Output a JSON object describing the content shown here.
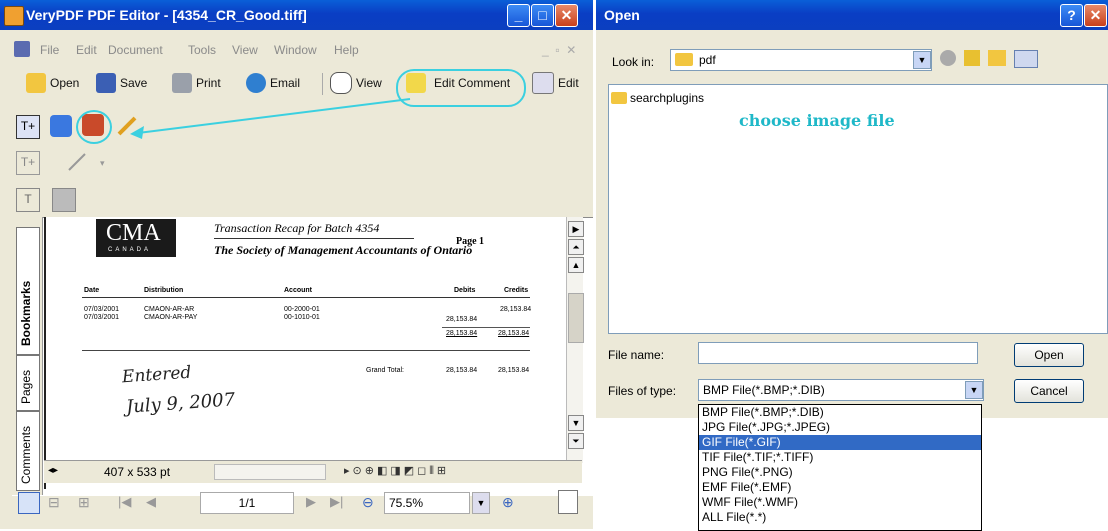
{
  "editor": {
    "title": "VeryPDF PDF Editor - [4354_CR_Good.tiff]",
    "menu": [
      "File",
      "Edit",
      "Document",
      "Tools",
      "View",
      "Window",
      "Help"
    ],
    "toolbar": {
      "open": "Open",
      "save": "Save",
      "print": "Print",
      "email": "Email",
      "view": "View",
      "edit_comment": "Edit Comment",
      "edit": "Edit"
    },
    "side_tabs": {
      "bookmarks": "Bookmarks",
      "pages": "Pages",
      "comments": "Comments"
    },
    "document": {
      "logo_main": "CMA",
      "logo_sub": "CANADA",
      "recap_title": "Transaction Recap for Batch 4354",
      "page_label": "Page 1",
      "society": "The Society of Management Accountants of Ontario",
      "headers": [
        "Date",
        "Distribution",
        "Account",
        "Debits",
        "Credits"
      ],
      "rows": [
        {
          "date": "07/03/2001",
          "dist": "CMAON-AR-AR",
          "acct": "00-2000-01",
          "debit": "",
          "credit": "28,153.84"
        },
        {
          "date": "07/03/2001",
          "dist": "CMAON-AR-PAY",
          "acct": "00-1010-01",
          "debit": "28,153.84",
          "credit": ""
        }
      ],
      "subtotal_debit": "28,153.84",
      "subtotal_credit": "28,153.84",
      "grand_total_label": "Grand Total:",
      "grand_debit": "28,153.84",
      "grand_credit": "28,153.84",
      "handwriting_1": "Entered",
      "handwriting_2": "July 9, 2007"
    },
    "status": {
      "page_size": "407 x 533 pt"
    },
    "bottom": {
      "page_num": "1/1",
      "zoom": "75.5%"
    }
  },
  "dialog": {
    "title": "Open",
    "look_in_label": "Look in:",
    "look_in_value": "pdf",
    "files": [
      "searchplugins"
    ],
    "hint": "choose image file",
    "file_name_label": "File name:",
    "file_name_value": "",
    "file_type_label": "Files of type:",
    "file_type_value": "BMP File(*.BMP;*.DIB)",
    "open_btn": "Open",
    "cancel_btn": "Cancel",
    "type_options": [
      "BMP File(*.BMP;*.DIB)",
      "JPG File(*.JPG;*.JPEG)",
      "GIF File(*.GIF)",
      "TIF File(*.TIF;*.TIFF)",
      "PNG File(*.PNG)",
      "EMF File(*.EMF)",
      "WMF File(*.WMF)",
      "ALL File(*.*)"
    ],
    "selected_option_index": 2
  },
  "colors": {
    "titlebar": "#0a4ed0",
    "accent_ring": "#3bd0e0",
    "hint": "#1fb8c8",
    "selection": "#316ac5"
  }
}
